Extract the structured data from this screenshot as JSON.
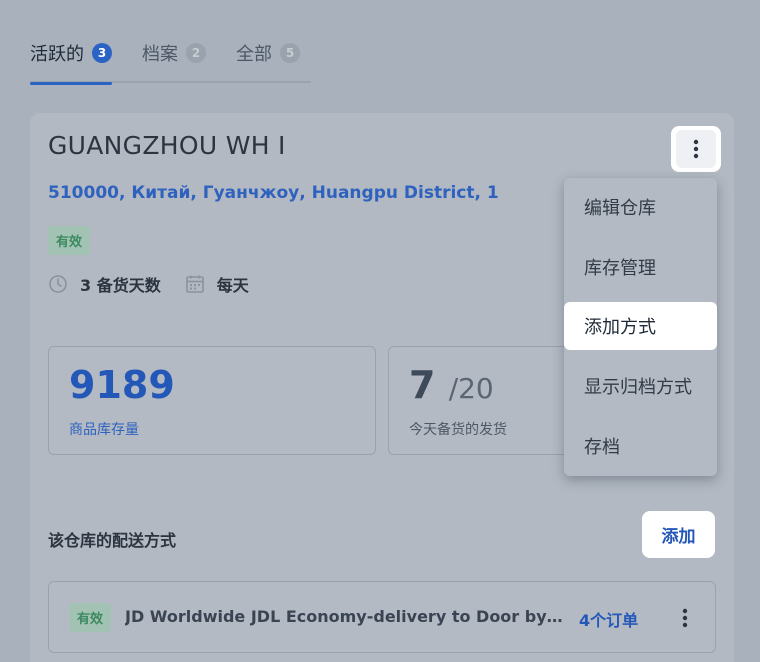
{
  "tabs": [
    {
      "label": "活跃的",
      "count": "3"
    },
    {
      "label": "档案",
      "count": "2"
    },
    {
      "label": "全部",
      "count": "5"
    }
  ],
  "warehouse": {
    "title": "GUANGZHOU WH I",
    "address": "510000, Китай, Гуанчжоу, Huangpu District, 1",
    "status": "有效",
    "prep_days": "3 备货天数",
    "schedule": "每天"
  },
  "stats": {
    "stock_value": "9189",
    "stock_label": "商品库存量",
    "today_value": "7",
    "today_total": "/20",
    "today_label": "今天备货的发货"
  },
  "section": {
    "label": "该仓库的配送方式",
    "add_label": "添加"
  },
  "delivery_row": {
    "status": "有效",
    "name": "JD Worldwide JDL Economy-delivery to Door by a...",
    "orders": "4个订单"
  },
  "menu": {
    "items": [
      "编辑仓库",
      "库存管理",
      "添加方式",
      "显示归档方式",
      "存档"
    ],
    "selected": "添加方式"
  },
  "colors": {
    "accent": "#2b63c4",
    "status_green": "#3c8a60",
    "background": "#a9b1bd"
  }
}
